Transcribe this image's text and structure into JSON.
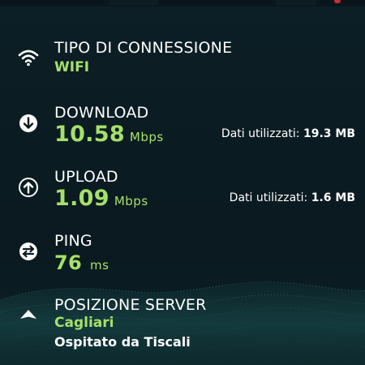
{
  "connection": {
    "label": "TIPO DI CONNESSIONE",
    "value": "WIFI",
    "icon": "wifi-icon"
  },
  "download": {
    "label": "DOWNLOAD",
    "value": "10.58",
    "unit": "Mbps",
    "data_used_label": "Dati utilizzati:",
    "data_used_value": "19.3 MB",
    "icon": "download-arrow-icon"
  },
  "upload": {
    "label": "UPLOAD",
    "value": "1.09",
    "unit": "Mbps",
    "data_used_label": "Dati utilizzati:",
    "data_used_value": "1.6 MB",
    "icon": "upload-arrow-icon"
  },
  "ping": {
    "label": "PING",
    "value": "76",
    "unit": "ms",
    "icon": "ping-arrows-icon"
  },
  "server": {
    "label": "POSIZIONE SERVER",
    "city": "Cagliari",
    "host": "Ospitato da Tiscali",
    "icon": "location-triangle-icon"
  },
  "colors": {
    "accent": "#a6e06a",
    "background": "#0b1a20",
    "text": "#ffffff"
  }
}
